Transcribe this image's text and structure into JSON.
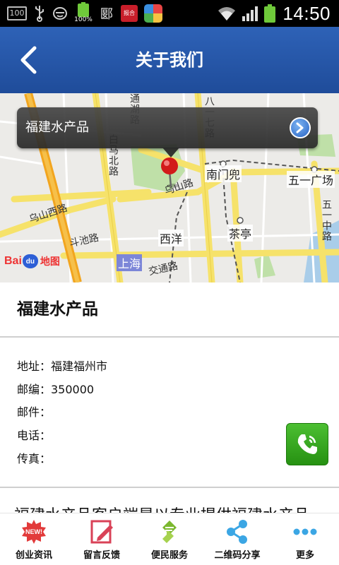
{
  "status_bar": {
    "time": "14:50",
    "battery_badge": "100%",
    "hundred_icon_text": "100",
    "app_badge_text": "报合",
    "hanzi_icon_text": "郾"
  },
  "header": {
    "title": "关于我们"
  },
  "map": {
    "callout_title": "福建水产品",
    "places": {
      "nanmendou": "南门兜",
      "wuyi_square": "五一广场",
      "xiyang": "西洋",
      "chating": "茶亭",
      "shanghai": "上海"
    },
    "roads": {
      "wushan_road_left": "乌山西路",
      "wushan_road": "乌山路",
      "baita_north": "白马北路",
      "douchi_road": "斗池路",
      "jiaotong_road": "交通路",
      "wuyi_middle": "五一中路",
      "tonghu_road": "通湖路",
      "bayiqi_road": "八一七路"
    },
    "logo": {
      "bai": "Bai",
      "du": "du",
      "ditu": "地图"
    }
  },
  "company": {
    "name": "福建水产品",
    "address": "地址：福建福州市",
    "postcode": "邮编：350000",
    "email": "邮件：",
    "phone": "电话：",
    "fax": "传真：",
    "description": "福建水产品客户端是以专业提供福建水产品"
  },
  "tabs": [
    {
      "label": "创业资讯",
      "icon": "new-badge-icon"
    },
    {
      "label": "留言反馈",
      "icon": "edit-note-icon"
    },
    {
      "label": "便民服务",
      "icon": "service-icon"
    },
    {
      "label": "二维码分享",
      "icon": "share-icon"
    },
    {
      "label": "更多",
      "icon": "more-icon"
    }
  ],
  "colors": {
    "header": "#2a5aaa",
    "phone_button": "#3aa822",
    "tab_new": "#e23a3a",
    "tab_edit": "#d94257",
    "tab_service": "#7cb82f",
    "tab_share": "#3ba6e4",
    "tab_more": "#3ba6e4"
  }
}
